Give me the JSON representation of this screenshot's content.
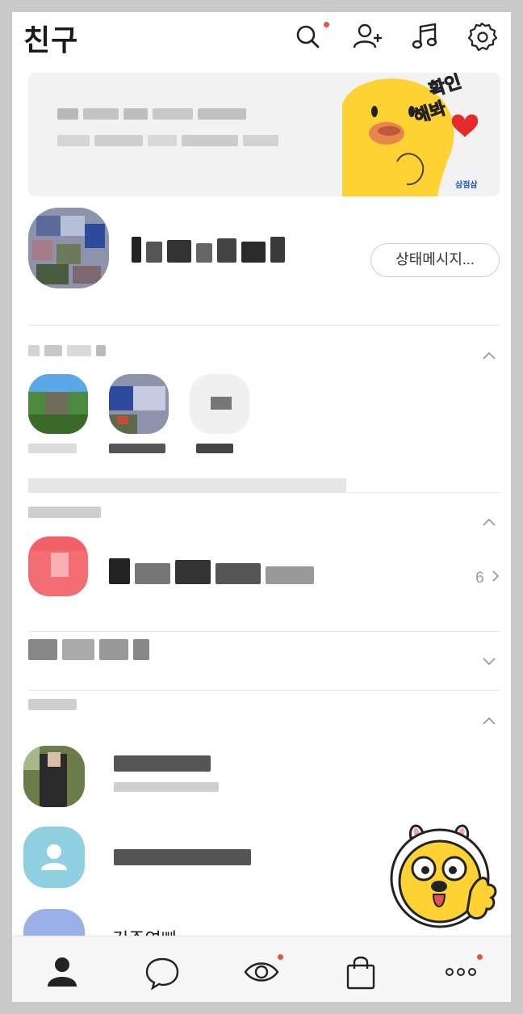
{
  "header": {
    "title": "친구",
    "icons": [
      "search-icon",
      "add-friend-icon",
      "music-icon",
      "settings-icon"
    ]
  },
  "banner": {
    "sticker_text_top": "확인",
    "sticker_text_bottom": "해봐",
    "brand": "삼점삼"
  },
  "profile": {
    "status_button": "상태메시지..."
  },
  "channels": {
    "count": "6"
  },
  "friends": [
    {
      "name": ""
    },
    {
      "name": ""
    },
    {
      "name": "김주연빠"
    }
  ],
  "tabs": [
    "friends-tab",
    "chats-tab",
    "view-tab",
    "shopping-tab",
    "more-tab"
  ],
  "colors": {
    "accent_dot": "#e8553d",
    "sticker_yellow": "#ffd234"
  }
}
